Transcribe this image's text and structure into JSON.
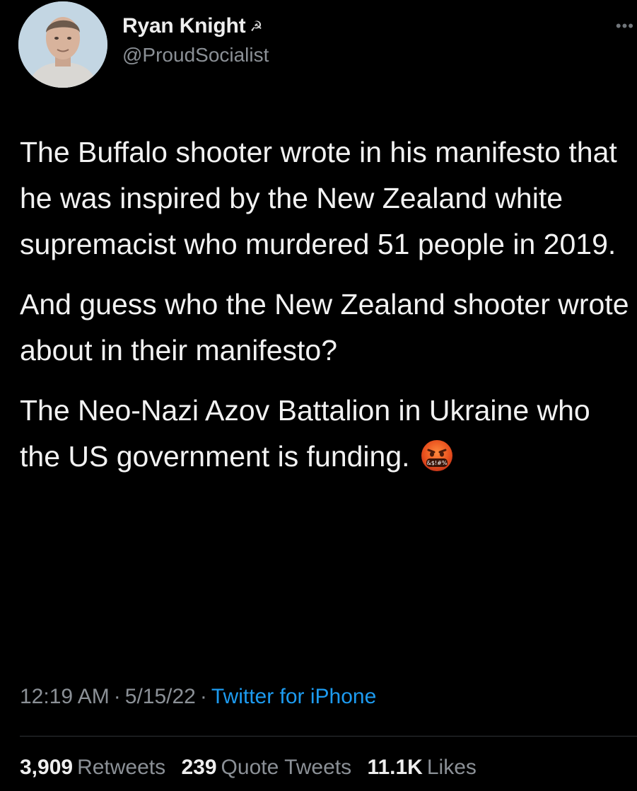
{
  "tweet": {
    "author": {
      "display_name": "Ryan Knight",
      "name_emoji": "☭",
      "handle": "@ProudSocialist",
      "avatar_icon": "profile-photo"
    },
    "more_icon": "ellipsis-icon",
    "paragraphs": [
      "The Buffalo shooter wrote in his manifesto that he was inspired by the New Zealand white supremacist who murdered 51 people in 2019.",
      "And guess who the New Zealand shooter wrote about in their manifesto?",
      "The Neo-Nazi Azov Battalion in Ukraine who the US government is funding."
    ],
    "emoji": "face-with-symbols-on-mouth",
    "time": "12:19 AM",
    "separator": "·",
    "date": "5/15/22",
    "source": "Twitter for iPhone",
    "stats": {
      "retweets_count": "3,909",
      "retweets_label": "Retweets",
      "quotes_count": "239",
      "quotes_label": "Quote Tweets",
      "likes_count": "11.1K",
      "likes_label": "Likes"
    }
  },
  "colors": {
    "background": "#000000",
    "text": "#f2f2f2",
    "secondary": "#8b9096",
    "link": "#1d9bf0",
    "divider": "#2f3336"
  }
}
